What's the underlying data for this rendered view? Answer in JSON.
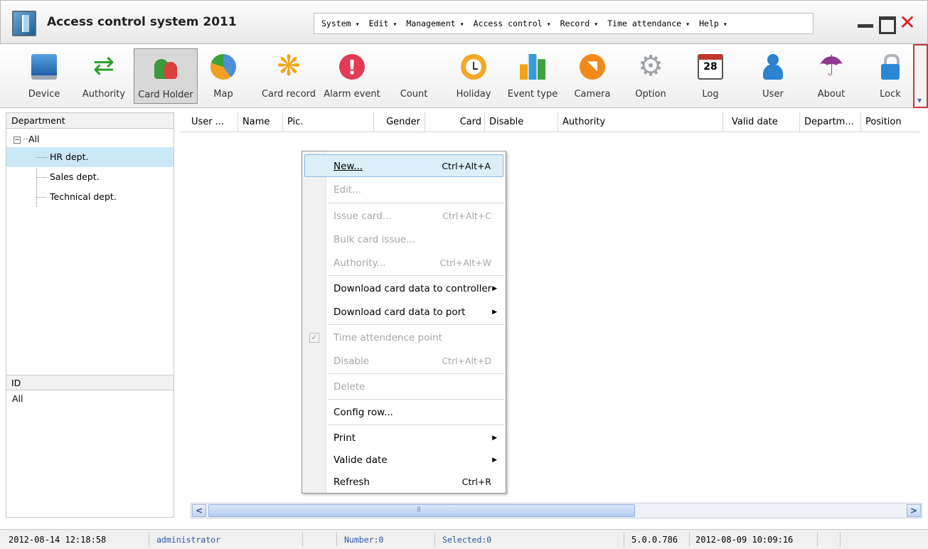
{
  "window": {
    "title": "Access control system 2011"
  },
  "menu": [
    "System",
    "Edit",
    "Management",
    "Access control",
    "Record",
    "Time attendance",
    "Help"
  ],
  "toolbar": [
    {
      "label": "Device",
      "icon": "device-icon"
    },
    {
      "label": "Authority",
      "icon": "authority-icon"
    },
    {
      "label": "Card Holder",
      "icon": "card-holder-icon",
      "active": true
    },
    {
      "label": "Map",
      "icon": "map-icon"
    },
    {
      "label": "Card record",
      "icon": "card-record-icon"
    },
    {
      "label": "Alarm event",
      "icon": "alarm-icon"
    },
    {
      "label": "Count",
      "icon": "count-icon"
    },
    {
      "label": "Holiday",
      "icon": "clock-icon"
    },
    {
      "label": "Event type",
      "icon": "bar-chart-icon"
    },
    {
      "label": "Camera",
      "icon": "camera-icon"
    },
    {
      "label": "Option",
      "icon": "gear-icon"
    },
    {
      "label": "Log",
      "icon": "calendar-icon"
    },
    {
      "label": "User",
      "icon": "user-icon"
    },
    {
      "label": "About",
      "icon": "umbrella-icon"
    },
    {
      "label": "Lock",
      "icon": "lock-icon"
    }
  ],
  "department": {
    "header": "Department",
    "root": "All",
    "children": [
      "HR dept.",
      "Sales dept.",
      "Technical dept."
    ],
    "selected": "HR dept."
  },
  "id_panel": {
    "header": "ID",
    "items": [
      "All"
    ]
  },
  "grid": {
    "columns": [
      "User ...",
      "Name",
      "Pic.",
      "Gender",
      "Card",
      "Disable",
      "Authority",
      "Valid date",
      "Departm...",
      "Position"
    ]
  },
  "context_menu": {
    "new": {
      "label": "New...",
      "shortcut": "Ctrl+Alt+A"
    },
    "edit": {
      "label": "Edit..."
    },
    "issue_card": {
      "label": "Issue card...",
      "shortcut": "Ctrl+Alt+C"
    },
    "bulk_card_issue": {
      "label": "Bulk card issue..."
    },
    "authority": {
      "label": "Authority...",
      "shortcut": "Ctrl+Alt+W"
    },
    "download_controller": {
      "label": "Download card data to controller"
    },
    "download_port": {
      "label": "Download card data to port"
    },
    "time_point": {
      "label": "Time attendence point"
    },
    "disable": {
      "label": "Disable",
      "shortcut": "Ctrl+Alt+D"
    },
    "delete": {
      "label": "Delete"
    },
    "config_row": {
      "label": "Config row..."
    },
    "print": {
      "label": "Print"
    },
    "valide_date": {
      "label": "Valide date"
    },
    "refresh": {
      "label": "Refresh",
      "shortcut": "Ctrl+R"
    }
  },
  "status": {
    "datetime": "2012-08-14 12:18:58",
    "user": "administrator",
    "number": "Number:0",
    "selected": "Selected:0",
    "version": "5.0.0.786",
    "build_date": "2012-08-09 10:09:16"
  },
  "colors": {
    "selection": "#cce8f6",
    "close_button": "#e21b1b",
    "status_text": "#2d57a7"
  }
}
